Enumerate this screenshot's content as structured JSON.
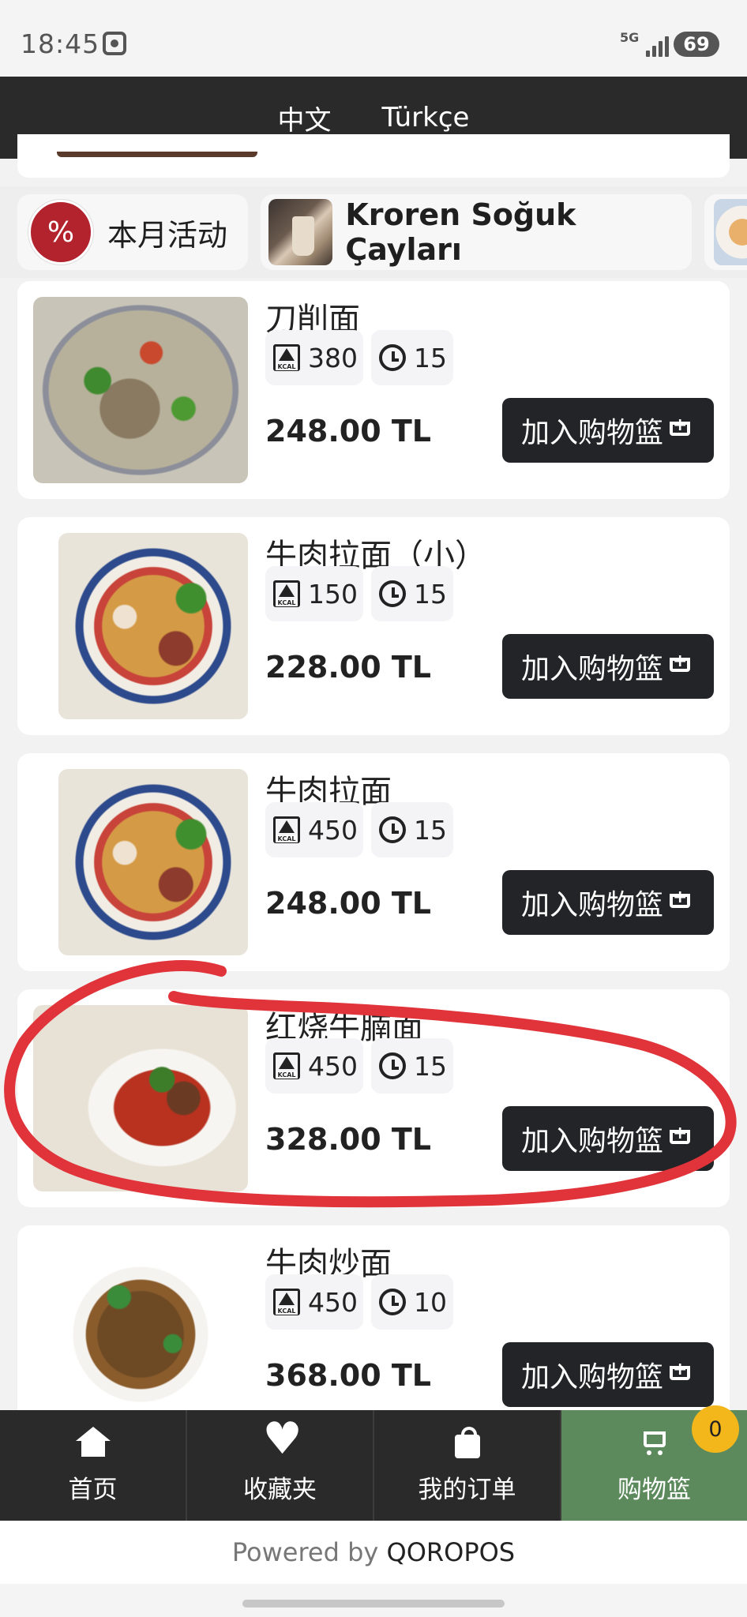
{
  "status_bar": {
    "time": "18:45",
    "network": "5G",
    "battery": "69"
  },
  "language_bar": {
    "languages": [
      "中文",
      "Türkçe"
    ]
  },
  "categories": [
    {
      "label": "本月活动",
      "icon": "percent-icon"
    },
    {
      "label": "Kroren Soğuk Çayları",
      "icon": "tea-thumbnail"
    }
  ],
  "products": [
    {
      "name": "刀削面",
      "kcal": "380",
      "minutes": "15",
      "price": "248.00 TL",
      "add_label": "加入购物篮"
    },
    {
      "name": "牛肉拉面（小）",
      "kcal": "150",
      "minutes": "15",
      "price": "228.00 TL",
      "add_label": "加入购物篮"
    },
    {
      "name": "牛肉拉面",
      "kcal": "450",
      "minutes": "15",
      "price": "248.00 TL",
      "add_label": "加入购物篮"
    },
    {
      "name": "红烧牛腩面",
      "kcal": "450",
      "minutes": "15",
      "price": "328.00 TL",
      "add_label": "加入购物篮"
    },
    {
      "name": "牛肉炒面",
      "kcal": "450",
      "minutes": "10",
      "price": "368.00 TL",
      "add_label": "加入购物篮"
    }
  ],
  "bottom_nav": {
    "items": [
      {
        "label": "首页",
        "icon": "home-icon"
      },
      {
        "label": "收藏夹",
        "icon": "heart-icon"
      },
      {
        "label": "我的订单",
        "icon": "bag-icon"
      },
      {
        "label": "购物篮",
        "icon": "cart-icon"
      }
    ],
    "cart_count": "0",
    "active_color": "#5d8a5d"
  },
  "footer": {
    "powered_by": "Powered by",
    "brand": "QOROPOS"
  },
  "colors": {
    "annotation": "#e0333a",
    "button": "#222427"
  }
}
